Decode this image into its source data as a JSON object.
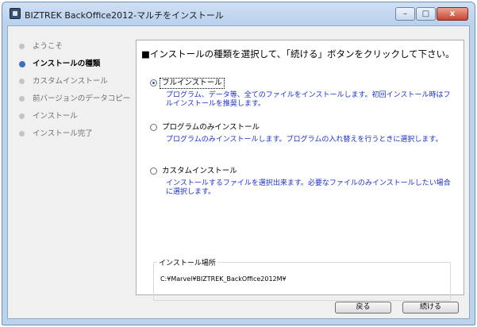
{
  "window": {
    "title": "BIZTREK BackOffice2012-マルチをインストール",
    "minimize_label": "–",
    "maximize_label": "□",
    "close_label": "x"
  },
  "steps": [
    {
      "label": "ようこそ",
      "active": false
    },
    {
      "label": "インストールの種類",
      "active": true
    },
    {
      "label": "カスタムインストール",
      "active": false
    },
    {
      "label": "前バージョンのデータコピー",
      "active": false
    },
    {
      "label": "インストール",
      "active": false
    },
    {
      "label": "インストール完了",
      "active": false
    }
  ],
  "panel": {
    "heading": "■インストールの種類を選択して、「続ける」ボタンをクリックして下さい。",
    "options": [
      {
        "label": "フルインストール",
        "selected": true,
        "description": "プログラム、データ等、全てのファイルをインストールします。初回インストール時はフルインストールを推奨します。"
      },
      {
        "label": "プログラムのみインストール",
        "selected": false,
        "description": "プログラムのみインストールします。プログラムの入れ替えを行うときに選択します。"
      },
      {
        "label": "カスタムインストール",
        "selected": false,
        "description": "インストールするファイルを選択出来ます。必要なファイルのみインストールしたい場合に選択します。"
      }
    ],
    "location": {
      "legend": "インストール場所",
      "path": "C:¥Marvel¥BIZTREK_BackOffice2012M¥"
    }
  },
  "buttons": {
    "back": "戻る",
    "continue": "続ける"
  },
  "colors": {
    "accent": "#3f6fbf",
    "description_text": "#1a2fd0",
    "title_bar": "#bcd3ee"
  }
}
